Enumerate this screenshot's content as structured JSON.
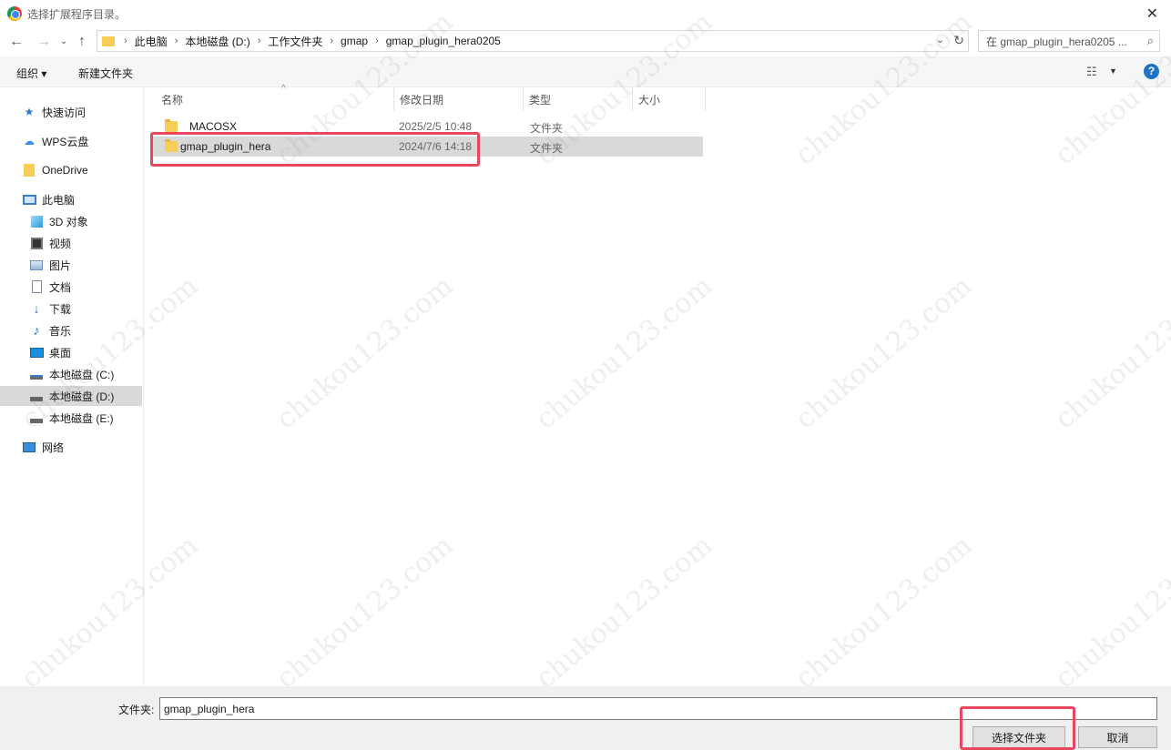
{
  "window": {
    "title": "选择扩展程序目录。"
  },
  "address": {
    "crumbs": [
      "此电脑",
      "本地磁盘 (D:)",
      "工作文件夹",
      "gmap",
      "gmap_plugin_hera0205"
    ],
    "search_placeholder": "在 gmap_plugin_hera0205 ..."
  },
  "toolbar": {
    "organize": "组织 ▾",
    "new_folder": "新建文件夹"
  },
  "sidebar": {
    "items": [
      {
        "label": "快速访问",
        "icon": "star-icon"
      },
      {
        "label": "WPS云盘",
        "icon": "cloud-icon"
      },
      {
        "label": "OneDrive",
        "icon": "folder-icon"
      },
      {
        "label": "此电脑",
        "icon": "computer-icon"
      },
      {
        "label": "3D 对象",
        "icon": "cube-icon"
      },
      {
        "label": "视频",
        "icon": "video-icon"
      },
      {
        "label": "图片",
        "icon": "picture-icon"
      },
      {
        "label": "文档",
        "icon": "document-icon"
      },
      {
        "label": "下载",
        "icon": "download-icon"
      },
      {
        "label": "音乐",
        "icon": "music-icon"
      },
      {
        "label": "桌面",
        "icon": "desktop-icon"
      },
      {
        "label": "本地磁盘 (C:)",
        "icon": "drive-icon"
      },
      {
        "label": "本地磁盘 (D:)",
        "icon": "drive-icon"
      },
      {
        "label": "本地磁盘 (E:)",
        "icon": "drive-icon"
      },
      {
        "label": "网络",
        "icon": "network-icon"
      }
    ]
  },
  "table": {
    "columns": [
      "名称",
      "修改日期",
      "类型",
      "大小"
    ],
    "rows": [
      {
        "name": "MACOSX",
        "date": "2025/2/5 10:48",
        "type": "文件夹",
        "size": ""
      },
      {
        "name": "gmap_plugin_hera",
        "date": "2024/7/6 14:18",
        "type": "文件夹",
        "size": ""
      }
    ]
  },
  "footer": {
    "folder_label": "文件夹:",
    "folder_value": "gmap_plugin_hera",
    "select_button": "选择文件夹",
    "cancel_button": "取消"
  },
  "watermark": "chukou123.com",
  "colors": {
    "highlight": "#e8485f",
    "folder": "#f5cd57",
    "selected_row": "#d9d9d9"
  }
}
